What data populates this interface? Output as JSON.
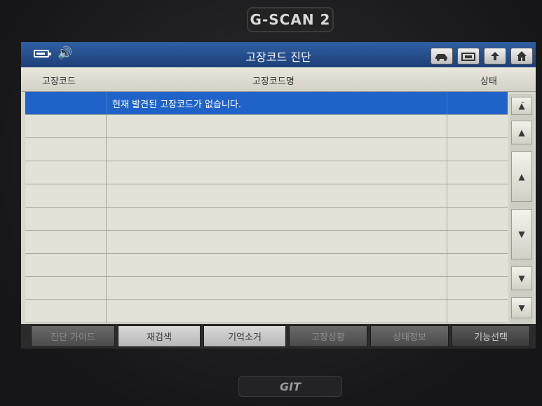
{
  "device": {
    "brand": "G-SCAN 2",
    "bottom_logo": "GIT"
  },
  "titlebar": {
    "title": "고장코드 진단",
    "icons": [
      "battery-icon",
      "speaker-icon",
      "car-icon",
      "print-icon",
      "back-icon",
      "home-icon"
    ]
  },
  "table": {
    "headers": {
      "code": "고장코드",
      "name": "고장코드명",
      "status": "상태"
    },
    "message": "현재 발견된 고장코드가 없습니다."
  },
  "tabs": [
    "진단 가이드",
    "재검색",
    "기억소거",
    "고장상황",
    "상태정보",
    "기능선택"
  ],
  "colors": {
    "title_blue": "#1d3f78",
    "selected_row": "#1f63c9"
  }
}
